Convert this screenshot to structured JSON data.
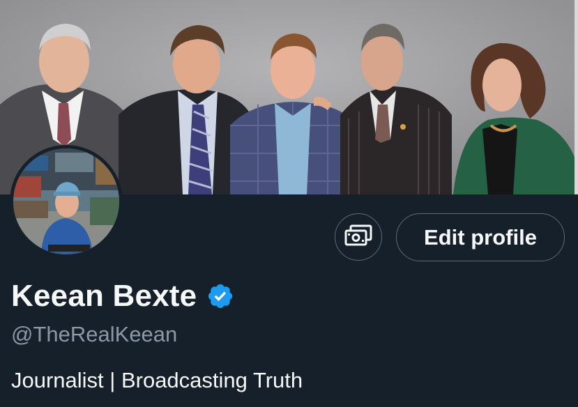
{
  "profile": {
    "display_name": "Keean Bexte",
    "handle": "@TheRealKeean",
    "bio": "Journalist | Broadcasting Truth",
    "verified": true
  },
  "actions": {
    "edit_label": "Edit profile",
    "tip_icon": "money-icon"
  },
  "images": {
    "banner": "group-photo-banner",
    "avatar": "profile-avatar-photo"
  },
  "colors": {
    "background": "#15202b",
    "primary_text": "#f7f9f9",
    "secondary_text": "#8b98a5",
    "button_border": "#5b6b7a",
    "verified_blue": "#1d9bf0"
  }
}
